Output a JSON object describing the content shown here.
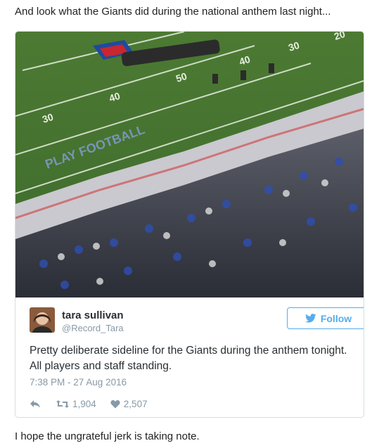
{
  "post": {
    "caption_top": "And look what the Giants did during the national anthem last night...",
    "caption_bottom": "I hope the ungrateful jerk is taking note."
  },
  "tweet": {
    "author_name": "tara sullivan",
    "author_handle": "@Record_Tara",
    "follow_label": "Follow",
    "text": "Pretty deliberate sideline for the Giants during the anthem tonight. All players and staff standing.",
    "timestamp": "7:38 PM - 27 Aug 2016",
    "retweets": "1,904",
    "likes": "2,507"
  },
  "photo": {
    "field_texts": [
      "30",
      "40",
      "50",
      "40",
      "30",
      "20"
    ],
    "endzone_text": "PLAY FOOTBALL",
    "icons": [
      "nfl-shield-logo",
      "reply-icon",
      "retweet-icon",
      "heart-icon",
      "twitter-bird-icon"
    ]
  },
  "colors": {
    "follow_blue": "#55acee",
    "text_gray": "#8899a6",
    "field_green": "#4f7a3a"
  }
}
